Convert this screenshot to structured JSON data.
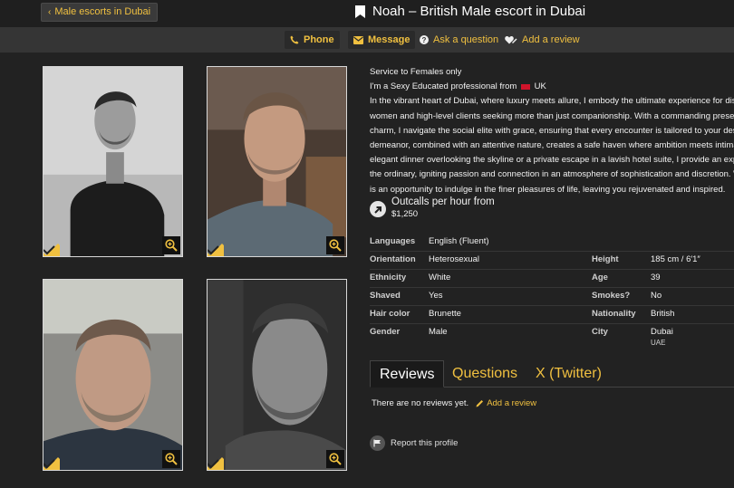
{
  "header": {
    "back_label": "Male escorts in Dubai",
    "title": "Noah – British Male escort in Dubai"
  },
  "actions": {
    "phone": "Phone",
    "message": "Message",
    "ask": "Ask a question",
    "add_review": "Add a review"
  },
  "profile": {
    "service": "Service to Females only",
    "intro_prefix": "I'm a Sexy Educated professional from",
    "intro_country": "UK",
    "bio_lines": [
      "In the vibrant heart of Dubai, where luxury meets allure, I embody the ultimate experience for discern",
      "women and high-level clients seeking more than just companionship. With a commanding presence",
      "charm, I navigate the social elite with grace, ensuring that every encounter is tailored to your desires",
      "demeanor, combined with an attentive nature, creates a safe haven where ambition meets intimacy.",
      "elegant dinner overlooking the skyline or a private escape in a lavish hotel suite, I provide an experie",
      "the ordinary, igniting passion and connection in an atmosphere of sophistication and discretion. With",
      "is an opportunity to indulge in the finer pleasures of life, leaving you rejuvenated and inspired."
    ],
    "outcalls_label": "Outcalls per hour from",
    "outcalls_price": "$1,250"
  },
  "attributes": {
    "languages": {
      "label": "Languages",
      "value": "English (Fluent)"
    },
    "orientation": {
      "label": "Orientation",
      "value": "Heterosexual"
    },
    "ethnicity": {
      "label": "Ethnicity",
      "value": "White"
    },
    "shaved": {
      "label": "Shaved",
      "value": "Yes"
    },
    "hair_color": {
      "label": "Hair color",
      "value": "Brunette"
    },
    "gender": {
      "label": "Gender",
      "value": "Male"
    },
    "height": {
      "label": "Height",
      "value": "185 cm / 6′1″"
    },
    "age": {
      "label": "Age",
      "value": "39"
    },
    "smokes": {
      "label": "Smokes?",
      "value": "No"
    },
    "nationality": {
      "label": "Nationality",
      "value": "British"
    },
    "city": {
      "label": "City",
      "value": "Dubai",
      "sub": "UAE"
    }
  },
  "tabs": {
    "reviews": "Reviews",
    "questions": "Questions",
    "twitter": "X (Twitter)"
  },
  "reviews": {
    "empty_text": "There are no reviews yet.",
    "add_link": "Add a review"
  },
  "report_label": "Report this profile",
  "colors": {
    "accent": "#f0c040",
    "background": "#222222",
    "bar": "#353535"
  }
}
